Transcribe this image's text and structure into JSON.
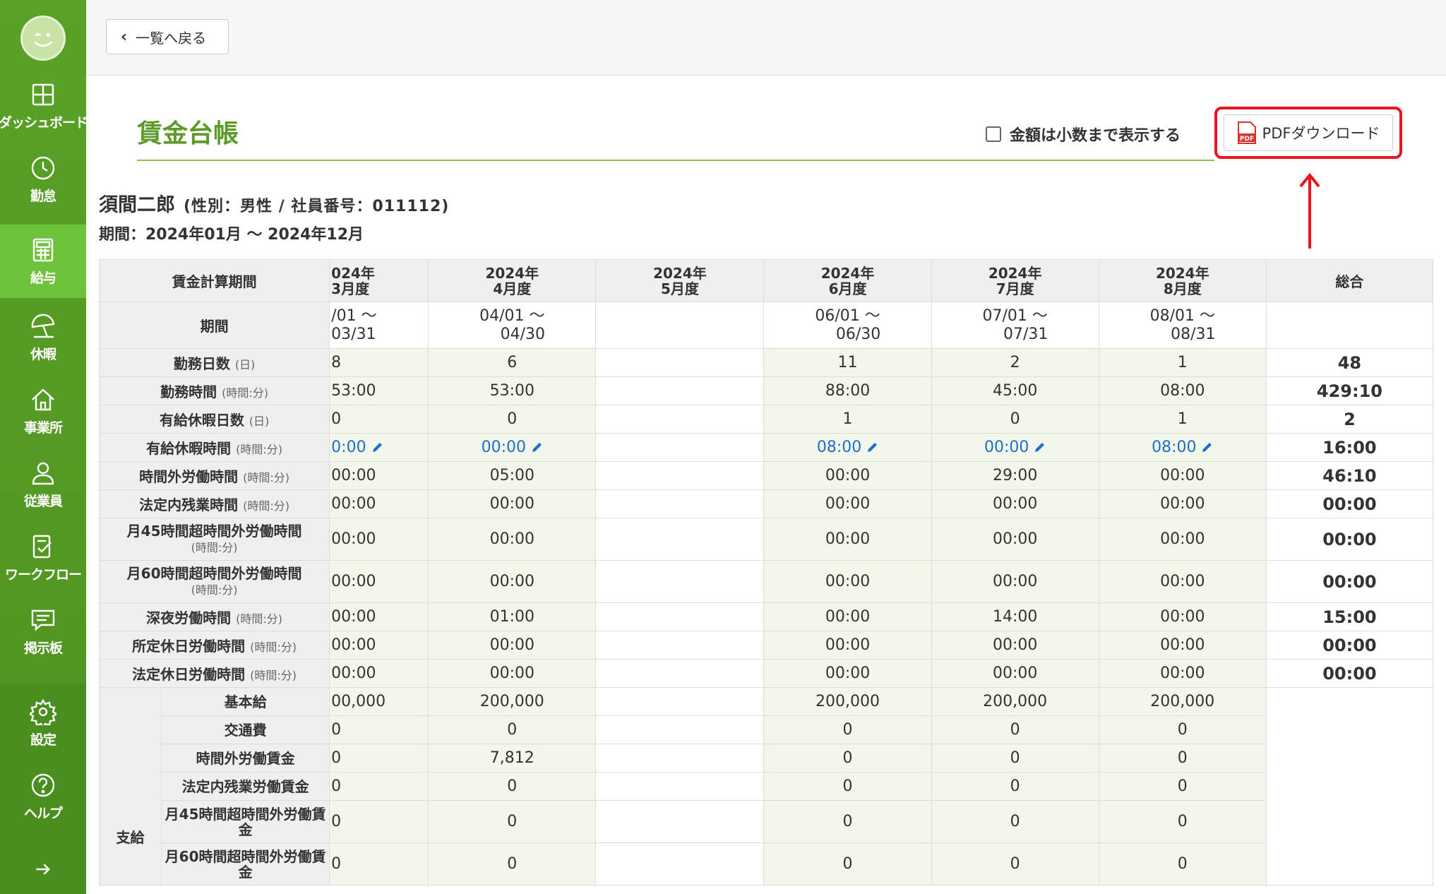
{
  "sidebar": {
    "items": [
      {
        "label": "ダッシュボード",
        "icon": "dashboard-icon"
      },
      {
        "label": "勤怠",
        "icon": "clock-icon"
      },
      {
        "label": "給与",
        "icon": "calculator-icon"
      },
      {
        "label": "休暇",
        "icon": "umbrella-icon"
      },
      {
        "label": "事業所",
        "icon": "home-icon"
      },
      {
        "label": "従業員",
        "icon": "user-icon"
      },
      {
        "label": "ワークフロー",
        "icon": "workflow-icon"
      },
      {
        "label": "掲示板",
        "icon": "message-icon"
      },
      {
        "label": "設定",
        "icon": "gear-icon"
      },
      {
        "label": "ヘルプ",
        "icon": "help-icon"
      }
    ],
    "expand_icon": "arrow-right-icon"
  },
  "topbar": {
    "back_label": "一覧へ戻る"
  },
  "page": {
    "title": "賃金台帳",
    "decimal_checkbox_label": "金額は小数まで表示する",
    "pdf_button_label": "PDFダウンロード"
  },
  "employee": {
    "name": "須間二郎",
    "meta": "(性別：男性 / 社員番号：011112)",
    "period": "期間：2024年01月 〜 2024年12月"
  },
  "table": {
    "header_label": "賃金計算期間",
    "columns": [
      {
        "year": "024年",
        "month": "3月度"
      },
      {
        "year": "2024年",
        "month": "4月度"
      },
      {
        "year": "2024年",
        "month": "5月度"
      },
      {
        "year": "2024年",
        "month": "6月度"
      },
      {
        "year": "2024年",
        "month": "7月度"
      },
      {
        "year": "2024年",
        "month": "8月度"
      }
    ],
    "total_label": "総合",
    "period_label": "期間",
    "periods": [
      {
        "start": "/01 〜",
        "end": "03/31"
      },
      {
        "start": "04/01 〜",
        "end": "04/30"
      },
      {
        "start": "",
        "end": ""
      },
      {
        "start": "06/01 〜",
        "end": "06/30"
      },
      {
        "start": "07/01 〜",
        "end": "07/31"
      },
      {
        "start": "08/01 〜",
        "end": "08/31"
      }
    ],
    "rows": [
      {
        "label": "勤務日数",
        "unit": "(日)",
        "values": [
          "8",
          "6",
          "",
          "11",
          "2",
          "1"
        ],
        "total": "48"
      },
      {
        "label": "勤務時間",
        "unit": "(時間:分)",
        "values": [
          "53:00",
          "53:00",
          "",
          "88:00",
          "45:00",
          "08:00"
        ],
        "total": "429:10"
      },
      {
        "label": "有給休暇日数",
        "unit": "(日)",
        "values": [
          "0",
          "0",
          "",
          "1",
          "0",
          "1"
        ],
        "total": "2"
      },
      {
        "label": "有給休暇時間",
        "unit": "(時間:分)",
        "values": [
          "0:00",
          "00:00",
          "",
          "08:00",
          "00:00",
          "08:00"
        ],
        "total": "16:00"
      },
      {
        "label": "時間外労働時間",
        "unit": "(時間:分)",
        "values": [
          "00:00",
          "05:00",
          "",
          "00:00",
          "29:00",
          "00:00"
        ],
        "total": "46:10"
      },
      {
        "label": "法定内残業時間",
        "unit": "(時間:分)",
        "values": [
          "00:00",
          "00:00",
          "",
          "00:00",
          "00:00",
          "00:00"
        ],
        "total": "00:00"
      },
      {
        "label": "月45時間超時間外労働時間",
        "unit": "(時間:分)",
        "values": [
          "00:00",
          "00:00",
          "",
          "00:00",
          "00:00",
          "00:00"
        ],
        "total": "00:00"
      },
      {
        "label": "月60時間超時間外労働時間",
        "unit": "(時間:分)",
        "values": [
          "00:00",
          "00:00",
          "",
          "00:00",
          "00:00",
          "00:00"
        ],
        "total": "00:00"
      },
      {
        "label": "深夜労働時間",
        "unit": "(時間:分)",
        "values": [
          "00:00",
          "01:00",
          "",
          "00:00",
          "14:00",
          "00:00"
        ],
        "total": "15:00"
      },
      {
        "label": "所定休日労働時間",
        "unit": "(時間:分)",
        "values": [
          "00:00",
          "00:00",
          "",
          "00:00",
          "00:00",
          "00:00"
        ],
        "total": "00:00"
      },
      {
        "label": "法定休日労働時間",
        "unit": "(時間:分)",
        "values": [
          "00:00",
          "00:00",
          "",
          "00:00",
          "00:00",
          "00:00"
        ],
        "total": "00:00"
      }
    ],
    "payment_group_label": "支給",
    "payment_rows": [
      {
        "label": "基本給",
        "values": [
          "00,000",
          "200,000",
          "",
          "200,000",
          "200,000",
          "200,000"
        ]
      },
      {
        "label": "交通費",
        "values": [
          "0",
          "0",
          "",
          "0",
          "0",
          "0"
        ]
      },
      {
        "label": "時間外労働賃金",
        "values": [
          "0",
          "7,812",
          "",
          "0",
          "0",
          "0"
        ]
      },
      {
        "label": "法定内残業労働賃金",
        "values": [
          "0",
          "0",
          "",
          "0",
          "0",
          "0"
        ]
      },
      {
        "label": "月45時間超時間外労働賃金",
        "values": [
          "0",
          "0",
          "",
          "0",
          "0",
          "0"
        ]
      },
      {
        "label": "月60時間超時間外労働賃金",
        "values": [
          "0",
          "0",
          "",
          "0",
          "0",
          "0"
        ]
      }
    ]
  },
  "colors": {
    "brand_green": "#5aa127",
    "title_green": "#5c9a2a",
    "link_blue": "#1c6fc7",
    "highlight_red": "#e8151e"
  }
}
